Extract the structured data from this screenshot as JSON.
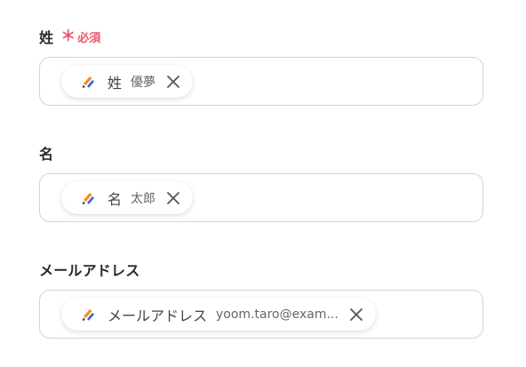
{
  "fields": [
    {
      "label": "姓",
      "required": true,
      "required_mark": "＊",
      "required_text": "必須",
      "chip": {
        "app_icon": "app-logo-icon",
        "label": "姓",
        "value": "優夢",
        "close_icon": "close-icon"
      }
    },
    {
      "label": "名",
      "required": false,
      "chip": {
        "app_icon": "app-logo-icon",
        "label": "名",
        "value": "太郎",
        "close_icon": "close-icon"
      }
    },
    {
      "label": "メールアドレス",
      "required": false,
      "chip": {
        "app_icon": "app-logo-icon",
        "label": "メールアドレス",
        "value": "yoom.taro@exam...",
        "close_icon": "close-icon"
      }
    }
  ],
  "colors": {
    "required": "#e8566c",
    "border": "#d4d4d4",
    "icon_orange": "#f28c28",
    "icon_blue": "#3a63d8",
    "icon_dark": "#1f2a44"
  }
}
